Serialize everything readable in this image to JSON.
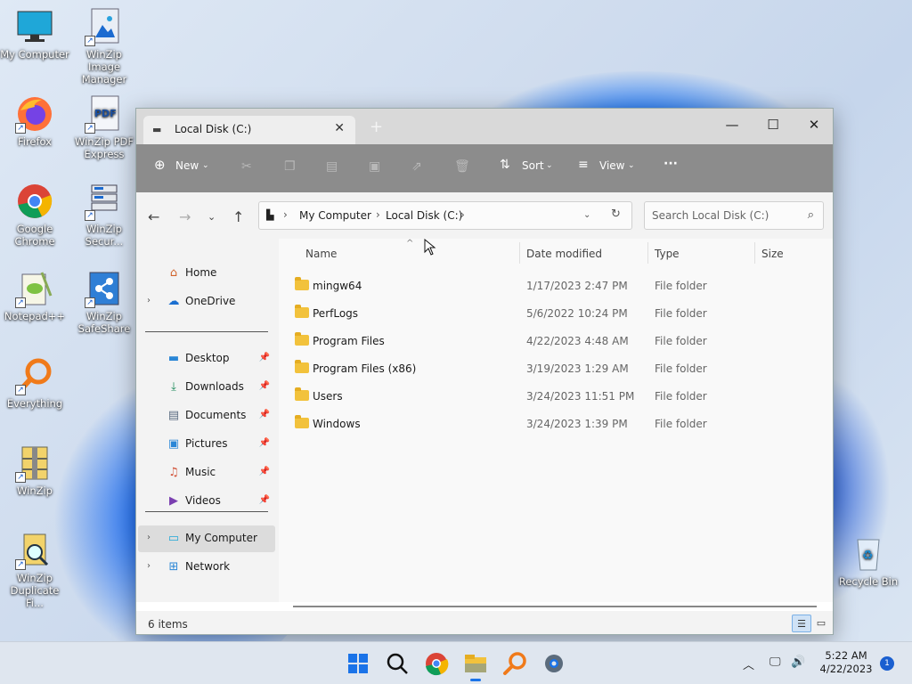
{
  "desktop": {
    "icons": [
      {
        "label": "My Computer",
        "icon": "monitor-icon"
      },
      {
        "label": "WinZip Image Manager",
        "icon": "winzip-image-icon"
      },
      {
        "label": "Firefox",
        "icon": "firefox-icon"
      },
      {
        "label": "WinZip PDF Express",
        "icon": "winzip-pdf-icon"
      },
      {
        "label": "Google Chrome",
        "icon": "chrome-icon"
      },
      {
        "label": "WinZip Secur...",
        "icon": "winzip-secure-icon"
      },
      {
        "label": "Notepad++",
        "icon": "notepadpp-icon"
      },
      {
        "label": "WinZip SafeShare",
        "icon": "winzip-safeshare-icon"
      },
      {
        "label": "Everything",
        "icon": "everything-search-icon"
      },
      {
        "label": "WinZip",
        "icon": "winzip-icon"
      },
      {
        "label": "WinZip Duplicate Fi...",
        "icon": "winzip-duplicate-icon"
      },
      {
        "label": "Recycle Bin",
        "icon": "recycle-bin-icon"
      }
    ],
    "pdf_badge": "PDF"
  },
  "window": {
    "tab_title": "Local Disk (C:)",
    "new_tab_glyph": "+",
    "toolbar": {
      "new_label": "New",
      "sort_label": "Sort",
      "view_label": "View",
      "more_label": "···"
    },
    "address": {
      "segments": [
        "My Computer",
        "Local Disk (C:)"
      ]
    },
    "search": {
      "placeholder": "Search Local Disk (C:)"
    },
    "sidebar": {
      "top": [
        {
          "label": "Home",
          "icon": "home-icon",
          "expandable": false
        },
        {
          "label": "OneDrive",
          "icon": "onedrive-cloud-icon",
          "expandable": true
        }
      ],
      "quick": [
        {
          "label": "Desktop",
          "icon": "desktop-folder-icon",
          "pinned": true
        },
        {
          "label": "Downloads",
          "icon": "download-arrow-icon",
          "pinned": true
        },
        {
          "label": "Documents",
          "icon": "documents-icon",
          "pinned": true
        },
        {
          "label": "Pictures",
          "icon": "pictures-icon",
          "pinned": true
        },
        {
          "label": "Music",
          "icon": "music-icon",
          "pinned": true
        },
        {
          "label": "Videos",
          "icon": "videos-icon",
          "pinned": true
        }
      ],
      "bottom": [
        {
          "label": "My Computer",
          "icon": "monitor-icon",
          "selected": true
        },
        {
          "label": "Network",
          "icon": "network-icon",
          "selected": false
        }
      ]
    },
    "columns": [
      "Name",
      "Date modified",
      "Type",
      "Size"
    ],
    "rows": [
      {
        "name": "mingw64",
        "date": "1/17/2023 2:47 PM",
        "type": "File folder"
      },
      {
        "name": "PerfLogs",
        "date": "5/6/2022 10:24 PM",
        "type": "File folder"
      },
      {
        "name": "Program Files",
        "date": "4/22/2023 4:48 AM",
        "type": "File folder"
      },
      {
        "name": "Program Files (x86)",
        "date": "3/19/2023 1:29 AM",
        "type": "File folder"
      },
      {
        "name": "Users",
        "date": "3/24/2023 11:51 PM",
        "type": "File folder"
      },
      {
        "name": "Windows",
        "date": "3/24/2023 1:39 PM",
        "type": "File folder"
      }
    ],
    "status": {
      "item_count": "6 items"
    }
  },
  "taskbar": {
    "apps": [
      "start-icon",
      "search-icon",
      "chrome-icon",
      "file-explorer-icon",
      "everything-search-icon",
      "settings-gear-icon"
    ],
    "clock_time": "5:22 AM",
    "clock_date": "4/22/2023",
    "notification_count": "1"
  },
  "colors": {
    "accent": "#1a73e8",
    "folder": "#f2c23c",
    "toolbar_bg": "#8c8c8c"
  }
}
